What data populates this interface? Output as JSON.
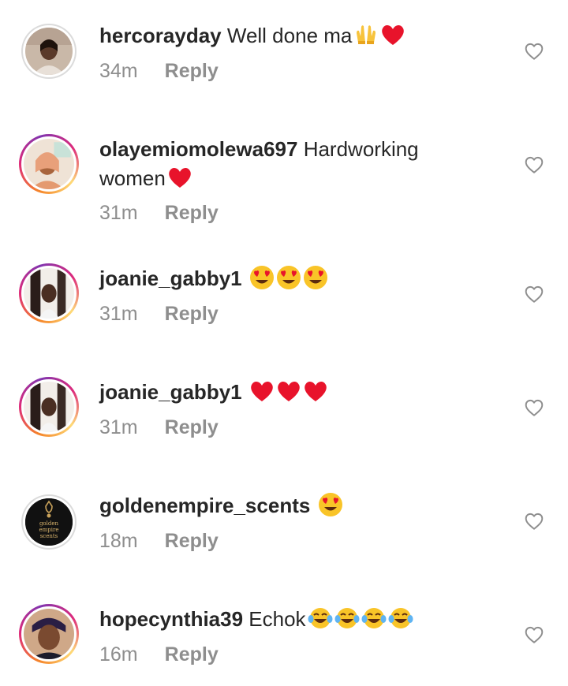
{
  "comments": [
    {
      "username": "hercorayday",
      "text": " Well done ma",
      "emojis": [
        "raising-hands-emoji",
        "red-heart-emoji"
      ],
      "time": "34m",
      "reply_label": "Reply"
    },
    {
      "username": "olayemiomolewa697",
      "text": " Hardworking women",
      "emojis": [
        "red-heart-emoji"
      ],
      "time": "31m",
      "reply_label": "Reply"
    },
    {
      "username": "joanie_gabby1",
      "text": " ",
      "emojis": [
        "heart-eyes-emoji",
        "heart-eyes-emoji",
        "heart-eyes-emoji"
      ],
      "time": "31m",
      "reply_label": "Reply"
    },
    {
      "username": "joanie_gabby1",
      "text": " ",
      "emojis": [
        "red-heart-emoji",
        "red-heart-emoji",
        "red-heart-emoji"
      ],
      "time": "31m",
      "reply_label": "Reply"
    },
    {
      "username": "goldenempire_scents",
      "text": " ",
      "emojis": [
        "heart-eyes-emoji"
      ],
      "time": "18m",
      "reply_label": "Reply",
      "avatar_logo_text": "golden empire scents"
    },
    {
      "username": "hopecynthia39",
      "text": " Echok",
      "emojis": [
        "tears-of-joy-emoji",
        "tears-of-joy-emoji",
        "tears-of-joy-emoji",
        "tears-of-joy-emoji"
      ],
      "time": "16m",
      "reply_label": "Reply"
    }
  ],
  "icons": {
    "like": "heart-outline-icon"
  },
  "colors": {
    "text": "#262626",
    "muted": "#8e8e8e",
    "emoji_heart": "#e8132b"
  }
}
